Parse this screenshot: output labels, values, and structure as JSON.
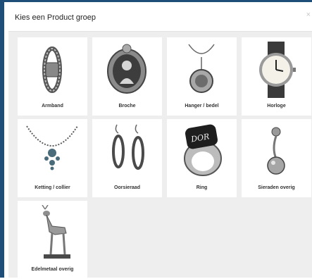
{
  "dialog": {
    "title": "Kies een Product groep",
    "close_glyph": "×"
  },
  "products": [
    {
      "label": "Armband",
      "icon": "bracelet-icon"
    },
    {
      "label": "Broche",
      "icon": "brooch-icon"
    },
    {
      "label": "Hanger / bedel",
      "icon": "pendant-icon"
    },
    {
      "label": "Horloge",
      "icon": "watch-icon"
    },
    {
      "label": "Ketting / collier",
      "icon": "necklace-icon"
    },
    {
      "label": "Oorsieraad",
      "icon": "earrings-icon"
    },
    {
      "label": "Ring",
      "icon": "ring-icon"
    },
    {
      "label": "Sieraden overig",
      "icon": "body-jewelry-icon"
    },
    {
      "label": "Edelmetaal overig",
      "icon": "deer-figurine-icon"
    }
  ],
  "ring_engraving": "DOR",
  "colors": {
    "frame": "#1f4e79",
    "body_background": "#eeeeee",
    "tile_background": "#ffffff",
    "silver": "#9a9a9a",
    "dark_metal": "#3a3a3a"
  }
}
